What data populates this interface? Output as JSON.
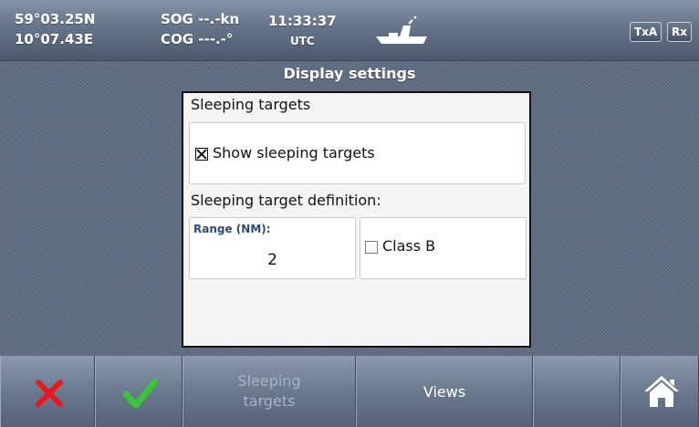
{
  "status": {
    "lat": "59°03.25N",
    "lon": "10°07.43E",
    "sog": "SOG --.-kn",
    "cog": "COG ---.-°",
    "time": "11:33:37",
    "tz": "UTC",
    "tx": "TxA",
    "rx": "Rx"
  },
  "dialog": {
    "title": "Display settings",
    "section1": "Sleeping targets",
    "show_sleeping": {
      "label": "Show sleeping targets",
      "checked": true
    },
    "section2": "Sleeping target definition:",
    "range": {
      "label": "Range (NM):",
      "value": "2"
    },
    "class_b": {
      "label": "Class B",
      "checked": false
    }
  },
  "toolbar": {
    "buttons": [
      {
        "name": "cancel",
        "icon": "red-x-icon"
      },
      {
        "name": "confirm",
        "icon": "green-check-icon"
      },
      {
        "name": "sleeping-targets",
        "label_line1": "Sleeping",
        "label_line2": "targets",
        "enabled": false
      },
      {
        "name": "views",
        "label": "Views"
      },
      {
        "name": "blank"
      },
      {
        "name": "home",
        "icon": "home-icon"
      }
    ]
  },
  "colors": {
    "accent_red": "#e8191e",
    "accent_green": "#3ac43a"
  }
}
